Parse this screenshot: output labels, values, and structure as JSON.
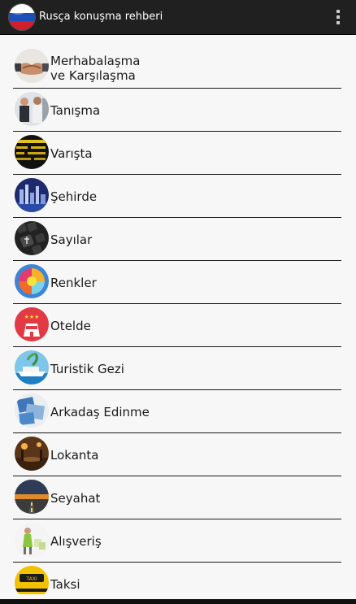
{
  "app": {
    "title": "Rusça konuşma rehberi",
    "logo_icon": "russian-flag-icon",
    "menu_icon": "overflow-menu-icon"
  },
  "topics": [
    {
      "label": "Merhabalaşma\nve Karşılaşma",
      "icon": "handshake-icon"
    },
    {
      "label": "Tanışma",
      "icon": "people-meeting-icon"
    },
    {
      "label": "Varışta",
      "icon": "departure-board-icon"
    },
    {
      "label": "Şehirde",
      "icon": "city-skyline-icon"
    },
    {
      "label": "Sayılar",
      "icon": "numbers-keyboard-icon"
    },
    {
      "label": "Renkler",
      "icon": "colorful-rose-icon"
    },
    {
      "label": "Otelde",
      "icon": "hotel-stars-icon"
    },
    {
      "label": "Turistik Gezi",
      "icon": "cruise-ship-icon"
    },
    {
      "label": "Arkadaş Edinme",
      "icon": "friends-photos-icon"
    },
    {
      "label": "Lokanta",
      "icon": "restaurant-icon"
    },
    {
      "label": "Seyahat",
      "icon": "road-trip-icon"
    },
    {
      "label": "Alışveriş",
      "icon": "shopping-icon"
    },
    {
      "label": "Taksi",
      "icon": "taxi-icon"
    }
  ]
}
